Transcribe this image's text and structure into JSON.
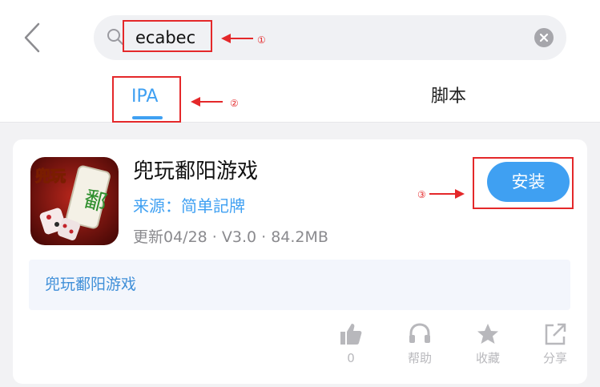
{
  "search": {
    "query": "ecabec"
  },
  "tabs": [
    {
      "label": "IPA",
      "active": true
    },
    {
      "label": "脚本",
      "active": false
    }
  ],
  "annotations": [
    "①",
    "②",
    "③"
  ],
  "app": {
    "icon_text_main": "兜玩",
    "icon_text_tile": "鄱",
    "name": "兜玩鄱阳游戏",
    "source": "来源：简单記牌",
    "meta": "更新04/28 · V3.0 · 84.2MB",
    "install_label": "安装",
    "description": "兜玩鄱阳游戏"
  },
  "actions": [
    {
      "icon": "thumbs-up-icon",
      "label": "0"
    },
    {
      "icon": "headset-icon",
      "label": "帮助"
    },
    {
      "icon": "star-icon",
      "label": "收藏"
    },
    {
      "icon": "share-icon",
      "label": "分享"
    }
  ],
  "colors": {
    "accent": "#3fa0f2",
    "annotation": "#e4282a",
    "background": "#f2f2f4"
  }
}
